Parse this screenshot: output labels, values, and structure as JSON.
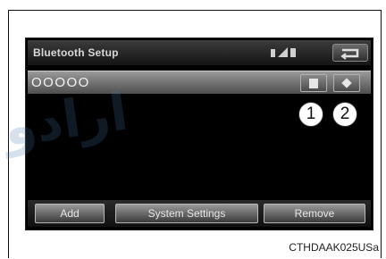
{
  "screen": {
    "title": "Bluetooth Setup",
    "device_name": "OOOOO",
    "status_icons": [
      "bluetooth-icon",
      "signal-icon",
      "battery-icon"
    ],
    "back_icon": "back-icon",
    "device_buttons": [
      {
        "icon": "phone-icon"
      },
      {
        "icon": "audio-icon"
      }
    ],
    "buttons": {
      "add": "Add",
      "system_settings": "System Settings",
      "remove": "Remove"
    }
  },
  "callouts": [
    "1",
    "2"
  ],
  "watermark": "ارادو",
  "caption": "CTHDAAK025USa"
}
